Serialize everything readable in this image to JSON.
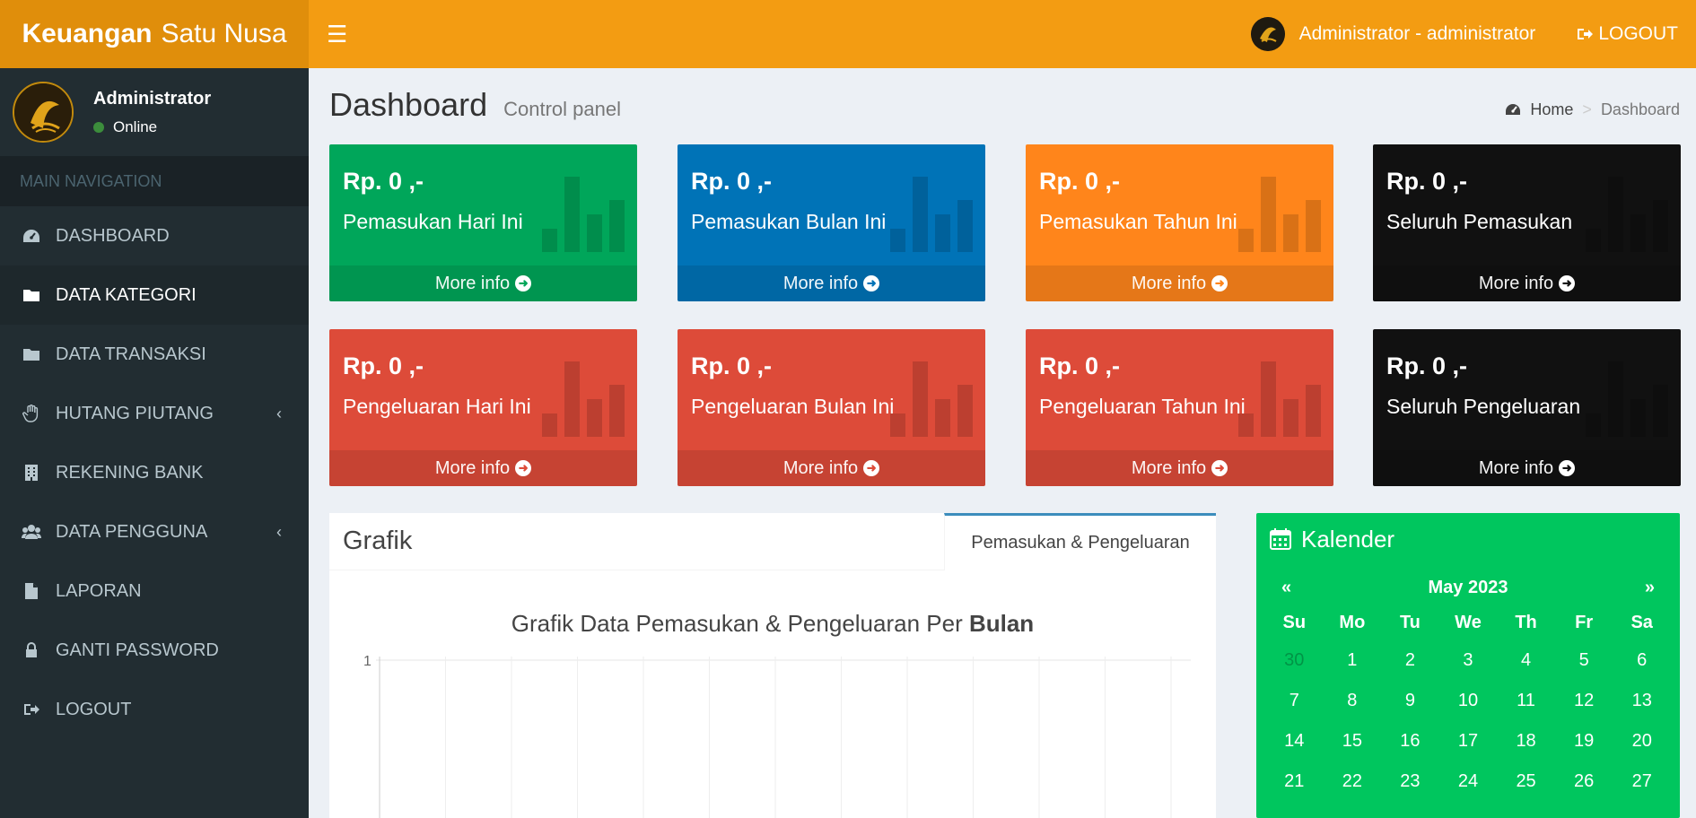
{
  "header": {
    "brand_bold": "Keuangan",
    "brand_light": "Satu Nusa",
    "user_label": "Administrator - administrator",
    "logout_label": "LOGOUT",
    "bg_color": "#f39c12"
  },
  "sidebar": {
    "user_name": "Administrator",
    "user_status": "Online",
    "nav_header": "MAIN NAVIGATION",
    "items": [
      {
        "label": "DASHBOARD",
        "icon": "dashboard-icon"
      },
      {
        "label": "DATA KATEGORI",
        "icon": "folder-icon",
        "active": true
      },
      {
        "label": "DATA TRANSAKSI",
        "icon": "folder-icon"
      },
      {
        "label": "HUTANG PIUTANG",
        "icon": "hand-icon",
        "has_children": true
      },
      {
        "label": "REKENING BANK",
        "icon": "building-icon"
      },
      {
        "label": "DATA PENGGUNA",
        "icon": "users-icon",
        "has_children": true
      },
      {
        "label": "LAPORAN",
        "icon": "file-icon"
      },
      {
        "label": "GANTI PASSWORD",
        "icon": "lock-icon"
      },
      {
        "label": "LOGOUT",
        "icon": "sign-out-icon"
      }
    ],
    "arrow_glyph": "‹"
  },
  "content_header": {
    "title": "Dashboard",
    "subtitle": "Control panel",
    "breadcrumb_home": "Home",
    "breadcrumb_sep": ">",
    "breadcrumb_current": "Dashboard"
  },
  "boxes": [
    {
      "amount": "Rp. 0 ,-",
      "label": "Pemasukan Hari Ini",
      "more": "More info",
      "color": "#00a65a"
    },
    {
      "amount": "Rp. 0 ,-",
      "label": "Pemasukan Bulan Ini",
      "more": "More info",
      "color": "#0073b7"
    },
    {
      "amount": "Rp. 0 ,-",
      "label": "Pemasukan Tahun Ini",
      "more": "More info",
      "color": "#ff851b"
    },
    {
      "amount": "Rp. 0 ,-",
      "label": "Seluruh Pemasukan",
      "more": "More info",
      "color": "#111111"
    },
    {
      "amount": "Rp. 0 ,-",
      "label": "Pengeluaran Hari Ini",
      "more": "More info",
      "color": "#dd4b39"
    },
    {
      "amount": "Rp. 0 ,-",
      "label": "Pengeluaran Bulan Ini",
      "more": "More info",
      "color": "#dd4b39"
    },
    {
      "amount": "Rp. 0 ,-",
      "label": "Pengeluaran Tahun Ini",
      "more": "More info",
      "color": "#dd4b39"
    },
    {
      "amount": "Rp. 0 ,-",
      "label": "Seluruh Pengeluaran",
      "more": "More info",
      "color": "#111111"
    }
  ],
  "grafik": {
    "title": "Grafik",
    "tab_label": "Pemasukan & Pengeluaran",
    "chart_title_prefix": "Grafik Data Pemasukan & Pengeluaran Per",
    "chart_title_bold": "Bulan",
    "y_tick_top": "1"
  },
  "kalender": {
    "title": "Kalender",
    "prev": "«",
    "next": "»",
    "month": "May 2023",
    "weekdays": [
      "Su",
      "Mo",
      "Tu",
      "We",
      "Th",
      "Fr",
      "Sa"
    ],
    "days": [
      "30",
      "1",
      "2",
      "3",
      "4",
      "5",
      "6",
      "7",
      "8",
      "9",
      "10",
      "11",
      "12",
      "13",
      "14",
      "15",
      "16",
      "17",
      "18",
      "19",
      "20",
      "21",
      "22",
      "23",
      "24",
      "25",
      "26",
      "27"
    ],
    "old_days": [
      "30"
    ]
  }
}
